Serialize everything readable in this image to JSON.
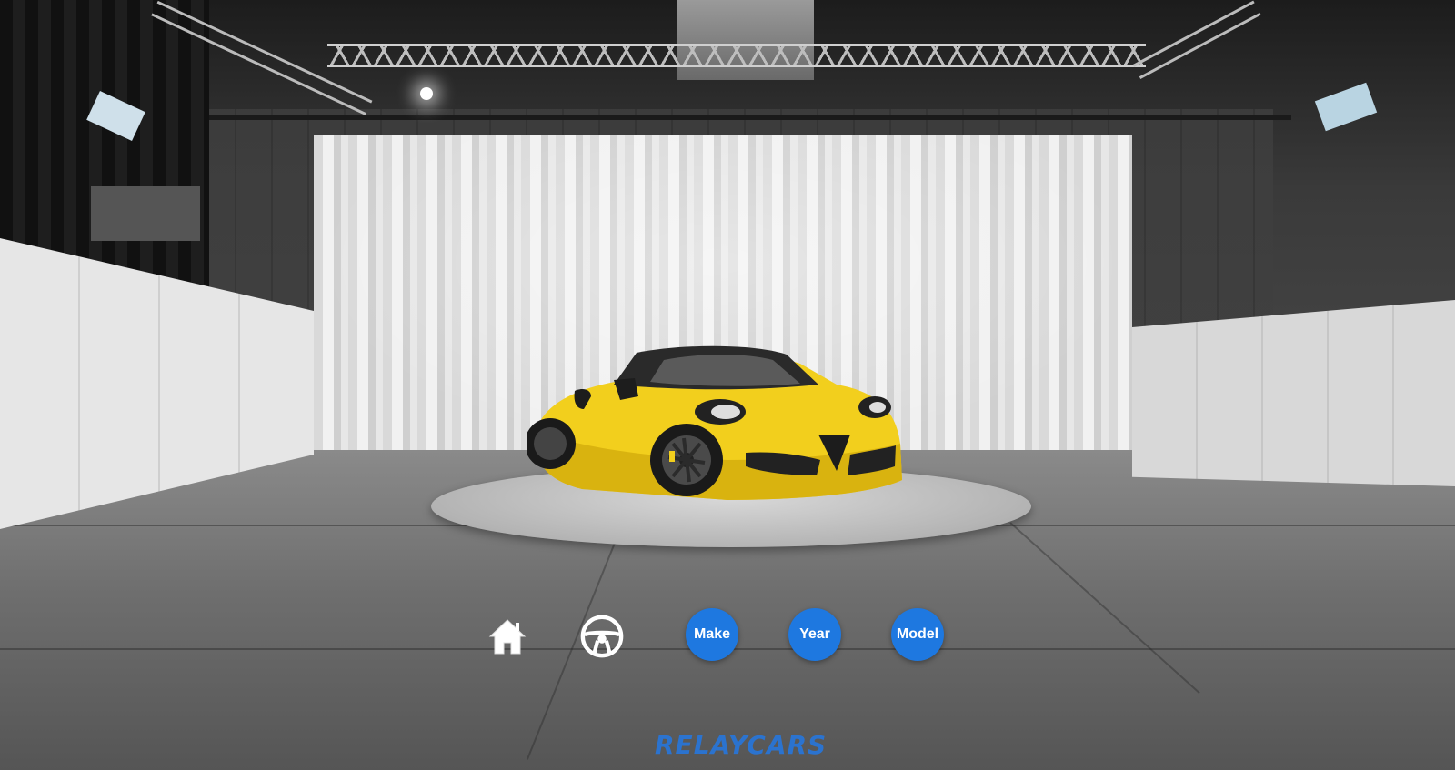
{
  "nav": {
    "home_icon": "home-icon",
    "steering_icon": "steering-wheel-icon"
  },
  "filters": {
    "make_label": "Make",
    "year_label": "Year",
    "model_label": "Model"
  },
  "brand": {
    "logo_text": "RELAYCARS"
  },
  "colors": {
    "button_blue": "#1e78e0",
    "logo_blue": "#2b73cf",
    "car_yellow": "#f2cf1d"
  }
}
